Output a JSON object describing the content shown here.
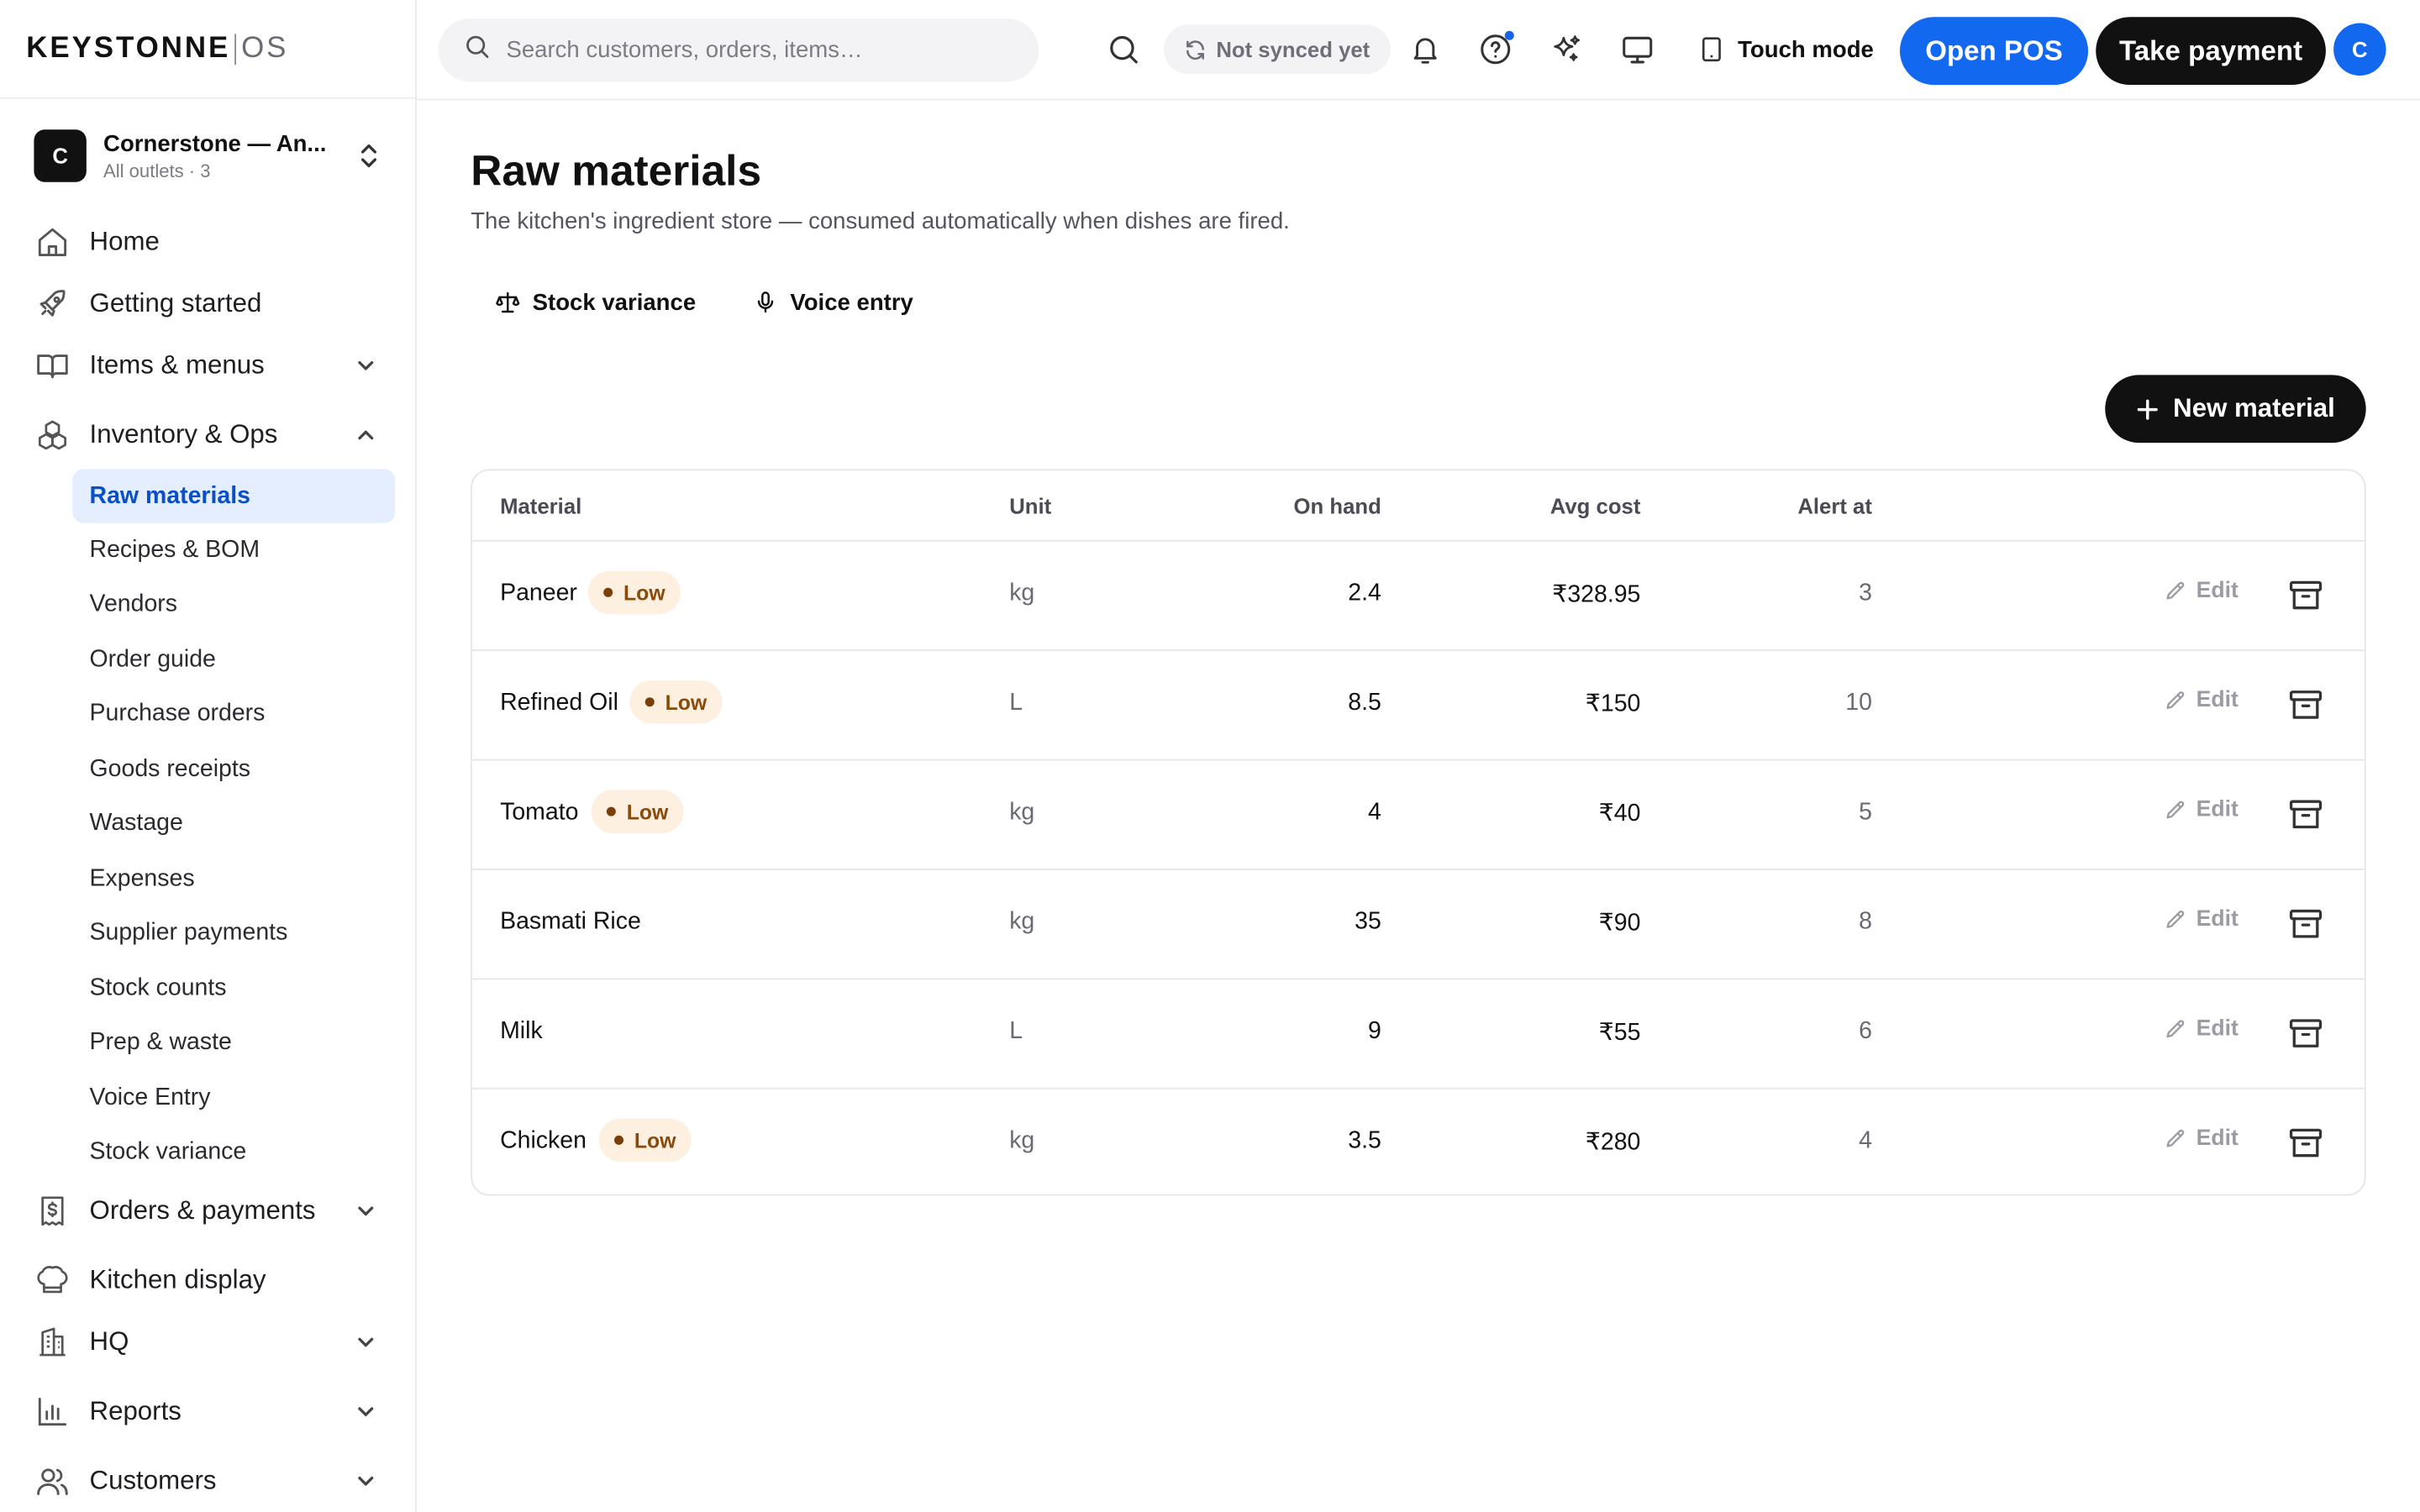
{
  "brand": {
    "primary": "KEYSTONNE",
    "secondary": "OS"
  },
  "outlet": {
    "initial": "C",
    "name": "Cornerstone — An...",
    "sub": "All outlets · 3"
  },
  "nav": {
    "home": "Home",
    "getting_started": "Getting started",
    "items_menus": "Items & menus",
    "inventory_ops": "Inventory & Ops",
    "orders_payments": "Orders & payments",
    "kitchen_display": "Kitchen display",
    "hq": "HQ",
    "reports": "Reports",
    "customers": "Customers"
  },
  "inventory_sub": [
    "Raw materials",
    "Recipes & BOM",
    "Vendors",
    "Order guide",
    "Purchase orders",
    "Goods receipts",
    "Wastage",
    "Expenses",
    "Supplier payments",
    "Stock counts",
    "Prep & waste",
    "Voice Entry",
    "Stock variance"
  ],
  "topbar": {
    "search_placeholder": "Search customers, orders, items…",
    "sync_status": "Not synced yet",
    "touch_mode": "Touch mode",
    "open_pos": "Open POS",
    "take_payment": "Take payment",
    "user_initial": "C"
  },
  "page": {
    "title": "Raw materials",
    "subtitle": "The kitchen's ingredient store — consumed automatically when dishes are fired.",
    "stock_variance": "Stock variance",
    "voice_entry": "Voice entry",
    "new_material": "New material"
  },
  "table": {
    "headers": {
      "material": "Material",
      "unit": "Unit",
      "on_hand": "On hand",
      "avg_cost": "Avg cost",
      "alert_at": "Alert at"
    },
    "edit_label": "Edit",
    "low_label": "Low",
    "rows": [
      {
        "material": "Paneer",
        "low": true,
        "unit": "kg",
        "on_hand": "2.4",
        "avg_cost": "₹328.95",
        "alert_at": "3"
      },
      {
        "material": "Refined Oil",
        "low": true,
        "unit": "L",
        "on_hand": "8.5",
        "avg_cost": "₹150",
        "alert_at": "10"
      },
      {
        "material": "Tomato",
        "low": true,
        "unit": "kg",
        "on_hand": "4",
        "avg_cost": "₹40",
        "alert_at": "5"
      },
      {
        "material": "Basmati Rice",
        "low": false,
        "unit": "kg",
        "on_hand": "35",
        "avg_cost": "₹90",
        "alert_at": "8"
      },
      {
        "material": "Milk",
        "low": false,
        "unit": "L",
        "on_hand": "9",
        "avg_cost": "₹55",
        "alert_at": "6"
      },
      {
        "material": "Chicken",
        "low": true,
        "unit": "kg",
        "on_hand": "3.5",
        "avg_cost": "₹280",
        "alert_at": "4"
      }
    ]
  },
  "colors": {
    "accent": "#1268ee",
    "dark": "#111111",
    "active_bg": "#e4eeff",
    "low_bg": "#fdf0e1",
    "low_text": "#8a4a0c"
  },
  "icons": [
    "search-icon",
    "sync-icon",
    "bell-icon",
    "help-icon",
    "sparkle-icon",
    "monitor-icon",
    "tablet-icon",
    "home-icon",
    "rocket-icon",
    "book-icon",
    "boxes-icon",
    "receipt-icon",
    "chef-hat-icon",
    "building-icon",
    "bar-chart-icon",
    "users-icon",
    "scale-icon",
    "mic-icon",
    "plus-icon",
    "pencil-icon",
    "archive-icon"
  ]
}
